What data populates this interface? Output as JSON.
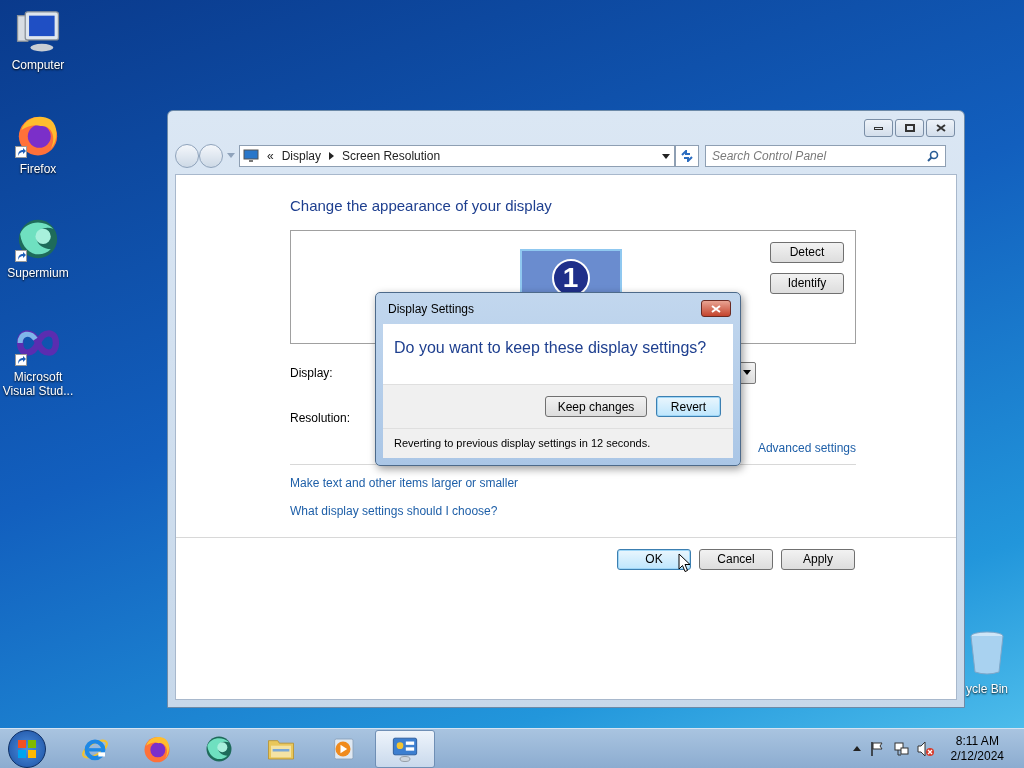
{
  "desktop_icons": [
    {
      "label": "Computer",
      "kind": "computer",
      "shortcut": false
    },
    {
      "label": "Firefox",
      "kind": "firefox",
      "shortcut": true
    },
    {
      "label": "Supermium",
      "kind": "supermium",
      "shortcut": true
    },
    {
      "label": "Microsoft Visual Stud...",
      "kind": "visualstudio",
      "shortcut": true
    }
  ],
  "recycle_bin": {
    "label": "ycle Bin"
  },
  "window": {
    "address": {
      "overflow": "«",
      "breadcrumb": [
        "Display",
        "Screen Resolution"
      ]
    },
    "search": {
      "placeholder": "Search Control Panel"
    },
    "heading": "Change the appearance of your display",
    "monitor_number": "1",
    "side_buttons": [
      {
        "label": "Detect"
      },
      {
        "label": "Identify"
      }
    ],
    "fields": [
      {
        "label": "Display:",
        "kind": "dropdown"
      },
      {
        "label": "Resolution:",
        "kind": "hidden"
      }
    ],
    "advanced_link": "Advanced settings",
    "links": [
      "Make text and other items larger or smaller",
      "What display settings should I choose?"
    ],
    "buttons": [
      {
        "label": "OK",
        "default": true
      },
      {
        "label": "Cancel",
        "default": false
      },
      {
        "label": "Apply",
        "default": false
      }
    ]
  },
  "dialog": {
    "title": "Display Settings",
    "question": "Do you want to keep these display settings?",
    "buttons": [
      {
        "label": "Keep changes",
        "default": false
      },
      {
        "label": "Revert",
        "default": true
      }
    ],
    "countdown": "Reverting to previous display settings in 12 seconds."
  },
  "taskbar": {
    "items": [
      {
        "kind": "ie",
        "active": false
      },
      {
        "kind": "firefox",
        "active": false
      },
      {
        "kind": "supermium",
        "active": false
      },
      {
        "kind": "explorer",
        "active": false
      },
      {
        "kind": "media",
        "active": false
      },
      {
        "kind": "controlpanel",
        "active": true
      }
    ],
    "time": "8:11 AM",
    "date": "2/12/2024"
  }
}
